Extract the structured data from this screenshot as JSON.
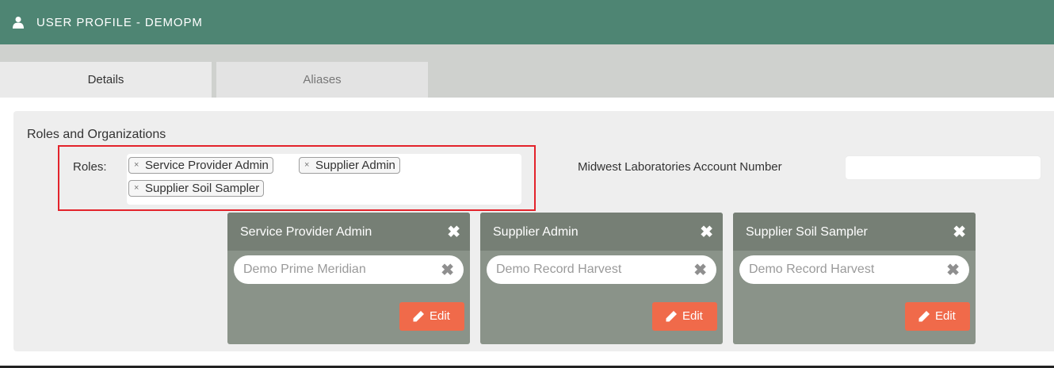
{
  "header": {
    "title": "USER PROFILE - DEMOPM",
    "icon": "user-icon"
  },
  "tabs": [
    {
      "label": "Details"
    },
    {
      "label": "Aliases"
    }
  ],
  "section": {
    "title": "Roles and Organizations"
  },
  "roles": {
    "label": "Roles:",
    "tags": [
      {
        "label": "Service Provider Admin"
      },
      {
        "label": "Supplier Admin"
      },
      {
        "label": "Supplier Soil Sampler"
      }
    ],
    "remove_glyph": "×"
  },
  "account": {
    "label": "Midwest Laboratories Account Number",
    "value": ""
  },
  "cards": [
    {
      "title": "Service Provider Admin",
      "org": "Demo Prime Meridian",
      "edit_label": "Edit"
    },
    {
      "title": "Supplier Admin",
      "org": "Demo Record Harvest",
      "edit_label": "Edit"
    },
    {
      "title": "Supplier Soil Sampler",
      "org": "Demo Record Harvest",
      "edit_label": "Edit"
    }
  ],
  "icons": {
    "close": "✖",
    "remove": "✖"
  },
  "colors": {
    "header": "#4e8573",
    "card": "#8a9389",
    "card_head": "#767f75",
    "edit": "#f06a4a",
    "highlight": "#e3232b"
  }
}
